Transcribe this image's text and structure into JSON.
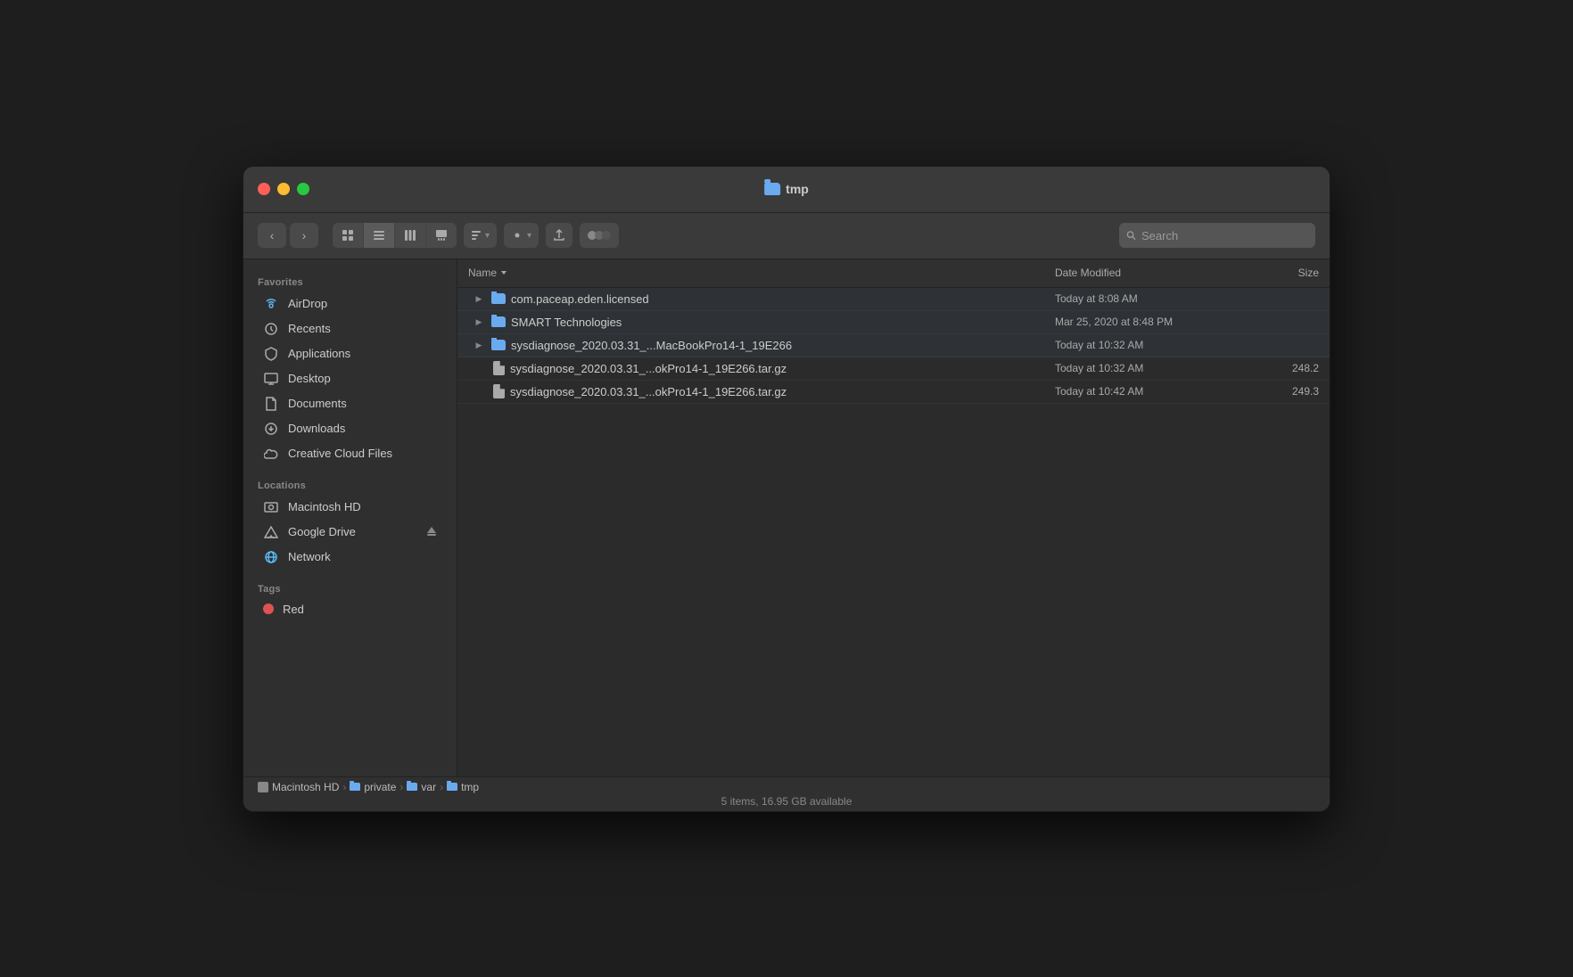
{
  "window": {
    "title": "tmp"
  },
  "toolbar": {
    "search_placeholder": "Search",
    "back_label": "‹",
    "forward_label": "›"
  },
  "view_buttons": [
    {
      "id": "icon-view",
      "icon": "⊞",
      "active": false
    },
    {
      "id": "list-view",
      "icon": "≡",
      "active": true
    },
    {
      "id": "column-view",
      "icon": "⊟",
      "active": false
    },
    {
      "id": "gallery-view",
      "icon": "⊠",
      "active": false
    }
  ],
  "sidebar": {
    "favorites_label": "Favorites",
    "locations_label": "Locations",
    "tags_label": "Tags",
    "favorites": [
      {
        "id": "airdrop",
        "label": "AirDrop",
        "icon": "airdrop"
      },
      {
        "id": "recents",
        "label": "Recents",
        "icon": "recents"
      },
      {
        "id": "applications",
        "label": "Applications",
        "icon": "applications"
      },
      {
        "id": "desktop",
        "label": "Desktop",
        "icon": "desktop"
      },
      {
        "id": "documents",
        "label": "Documents",
        "icon": "documents"
      },
      {
        "id": "downloads",
        "label": "Downloads",
        "icon": "downloads"
      },
      {
        "id": "creative-cloud",
        "label": "Creative Cloud Files",
        "icon": "cloud"
      }
    ],
    "locations": [
      {
        "id": "macintosh-hd",
        "label": "Macintosh HD",
        "icon": "macintosh"
      },
      {
        "id": "google-drive",
        "label": "Google Drive",
        "icon": "gdrive",
        "eject": true
      },
      {
        "id": "network",
        "label": "Network",
        "icon": "network"
      }
    ],
    "tags": [
      {
        "id": "red",
        "label": "Red",
        "color": "#e05252"
      }
    ]
  },
  "file_list": {
    "columns": {
      "name": "Name",
      "date_modified": "Date Modified",
      "size": "Size"
    },
    "rows": [
      {
        "id": "row1",
        "type": "folder",
        "name": "com.paceap.eden.licensed",
        "date_modified": "Today at 8:08 AM",
        "size": "",
        "expanded": false
      },
      {
        "id": "row2",
        "type": "folder",
        "name": "SMART Technologies",
        "date_modified": "Mar 25, 2020 at 8:48 PM",
        "size": "",
        "expanded": false
      },
      {
        "id": "row3",
        "type": "folder",
        "name": "sysdiagnose_2020.03.31_...MacBookPro14-1_19E266",
        "date_modified": "Today at 10:32 AM",
        "size": "",
        "expanded": false
      },
      {
        "id": "row4",
        "type": "file",
        "name": "sysdiagnose_2020.03.31_...okPro14-1_19E266.tar.gz",
        "date_modified": "Today at 10:32 AM",
        "size": "248.2"
      },
      {
        "id": "row5",
        "type": "file",
        "name": "sysdiagnose_2020.03.31_...okPro14-1_19E266.tar.gz",
        "date_modified": "Today at 10:42 AM",
        "size": "249.3"
      }
    ]
  },
  "statusbar": {
    "breadcrumb": [
      {
        "label": "Macintosh HD",
        "type": "hd"
      },
      {
        "label": "private",
        "type": "folder"
      },
      {
        "label": "var",
        "type": "folder"
      },
      {
        "label": "tmp",
        "type": "folder"
      }
    ],
    "status_text": "5 items, 16.95 GB available"
  }
}
